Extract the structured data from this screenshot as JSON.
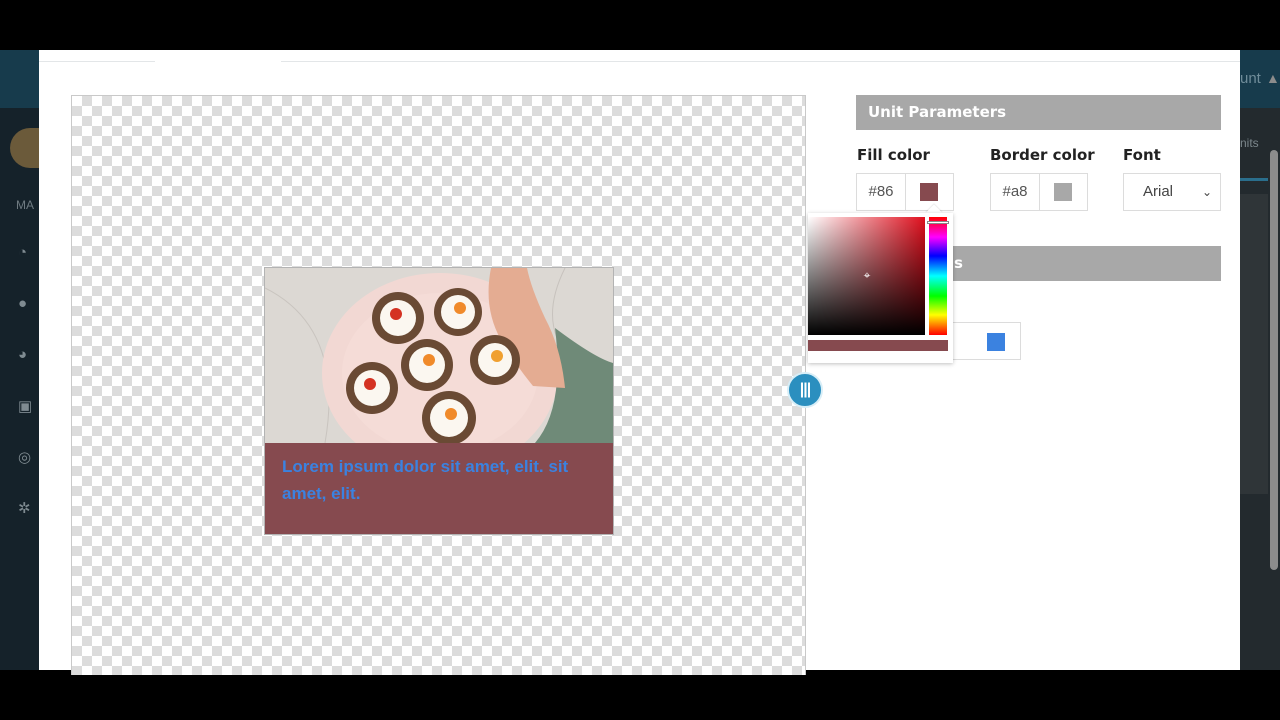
{
  "background_app": {
    "sidebar_header": "MA",
    "right_header_text": "unt",
    "right_tab_text": "nits",
    "sidebar_icons": [
      "dashboard-icon",
      "globe-icon",
      "pie-chart-icon",
      "money-icon",
      "lifebuoy-icon",
      "gear-icon"
    ]
  },
  "preview": {
    "unit_text": "Lorem ipsum dolor sit amet, elit. sit amet, elit.",
    "banner_color": "#864a4f",
    "text_color": "#3b82e0"
  },
  "panel": {
    "unit_parameters_title": "Unit Parameters",
    "second_section_title_partial": "s",
    "fill_color_label": "Fill color",
    "fill_color_value": "#86",
    "fill_swatch": "#864a4f",
    "border_color_label": "Border color",
    "border_color_value": "#a8",
    "border_swatch": "#a8a8a8",
    "font_label": "Font",
    "font_value": "Arial",
    "text_color_swatch": "#3b82e0"
  },
  "color_picker": {
    "hue": "#e0101e",
    "preview_color": "#864a4f"
  }
}
